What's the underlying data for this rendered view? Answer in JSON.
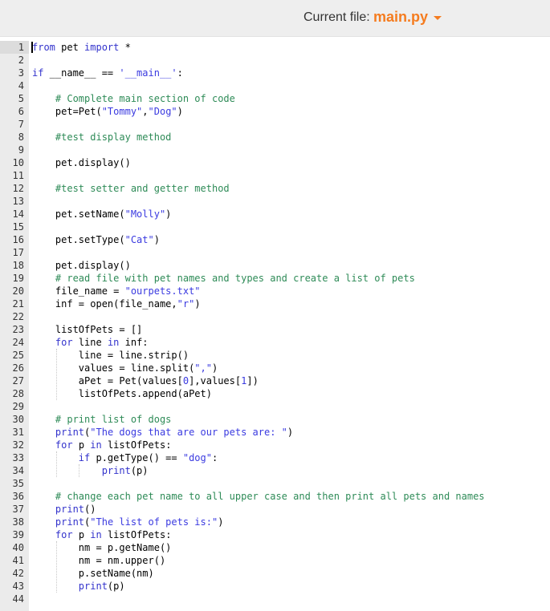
{
  "header": {
    "file_label": "Current file:",
    "file_name": "main.py",
    "dropdown_icon": "caret-down-icon",
    "accent_color": "#f57c1f"
  },
  "editor": {
    "active_line": 1,
    "lines": [
      {
        "n": "1",
        "html": "<span class='kw'>from</span> pet <span class='kw'>import</span> *"
      },
      {
        "n": "2",
        "html": ""
      },
      {
        "n": "3",
        "html": "<span class='kw'>if</span> __name__ == <span class='st'>'__main__'</span>:"
      },
      {
        "n": "4",
        "html": ""
      },
      {
        "n": "5",
        "html": "    <span class='cm'># Complete main section of code</span>"
      },
      {
        "n": "6",
        "html": "    pet=Pet(<span class='st'>\"Tommy\"</span>,<span class='st'>\"Dog\"</span>)"
      },
      {
        "n": "7",
        "html": ""
      },
      {
        "n": "8",
        "html": "    <span class='cm'>#test display method</span>"
      },
      {
        "n": "9",
        "html": ""
      },
      {
        "n": "10",
        "html": "    pet.display()"
      },
      {
        "n": "11",
        "html": ""
      },
      {
        "n": "12",
        "html": "    <span class='cm'>#test setter and getter method</span>"
      },
      {
        "n": "13",
        "html": ""
      },
      {
        "n": "14",
        "html": "    pet.setName(<span class='st'>\"Molly\"</span>)"
      },
      {
        "n": "15",
        "html": ""
      },
      {
        "n": "16",
        "html": "    pet.setType(<span class='st'>\"Cat\"</span>)"
      },
      {
        "n": "17",
        "html": ""
      },
      {
        "n": "18",
        "html": "    pet.display()"
      },
      {
        "n": "19",
        "html": "    <span class='cm'># read file with pet names and types and create a list of pets</span>"
      },
      {
        "n": "20",
        "html": "    file_name = <span class='st'>\"ourpets.txt\"</span>"
      },
      {
        "n": "21",
        "html": "    inf = open(file_name,<span class='st'>\"r\"</span>)"
      },
      {
        "n": "22",
        "html": ""
      },
      {
        "n": "23",
        "html": "    listOfPets = []"
      },
      {
        "n": "24",
        "html": "    <span class='kw'>for</span> line <span class='kw'>in</span> inf:"
      },
      {
        "n": "25",
        "html": "        line = line.strip()"
      },
      {
        "n": "26",
        "html": "        values = line.split(<span class='st'>\",\"</span>)"
      },
      {
        "n": "27",
        "html": "        aPet = Pet(values[<span class='num'>0</span>],values[<span class='num'>1</span>])"
      },
      {
        "n": "28",
        "html": "        listOfPets.append(aPet)"
      },
      {
        "n": "29",
        "html": ""
      },
      {
        "n": "30",
        "html": "    <span class='cm'># print list of dogs</span>"
      },
      {
        "n": "31",
        "html": "    <span class='kw'>print</span>(<span class='st'>\"The dogs that are our pets are: \"</span>)"
      },
      {
        "n": "32",
        "html": "    <span class='kw'>for</span> p <span class='kw'>in</span> listOfPets:"
      },
      {
        "n": "33",
        "html": "        <span class='kw'>if</span> p.getType() == <span class='st'>\"dog\"</span>:"
      },
      {
        "n": "34",
        "html": "            <span class='kw'>print</span>(p)"
      },
      {
        "n": "35",
        "html": ""
      },
      {
        "n": "36",
        "html": "    <span class='cm'># change each pet name to all upper case and then print all pets and names</span>"
      },
      {
        "n": "37",
        "html": "    <span class='kw'>print</span>()"
      },
      {
        "n": "38",
        "html": "    <span class='kw'>print</span>(<span class='st'>\"The list of pets is:\"</span>)"
      },
      {
        "n": "39",
        "html": "    <span class='kw'>for</span> p <span class='kw'>in</span> listOfPets:"
      },
      {
        "n": "40",
        "html": "        nm = p.getName()"
      },
      {
        "n": "41",
        "html": "        nm = nm.upper()"
      },
      {
        "n": "42",
        "html": "        p.setName(nm)"
      },
      {
        "n": "43",
        "html": "        <span class='kw'>print</span>(p)"
      },
      {
        "n": "44",
        "html": ""
      }
    ]
  }
}
